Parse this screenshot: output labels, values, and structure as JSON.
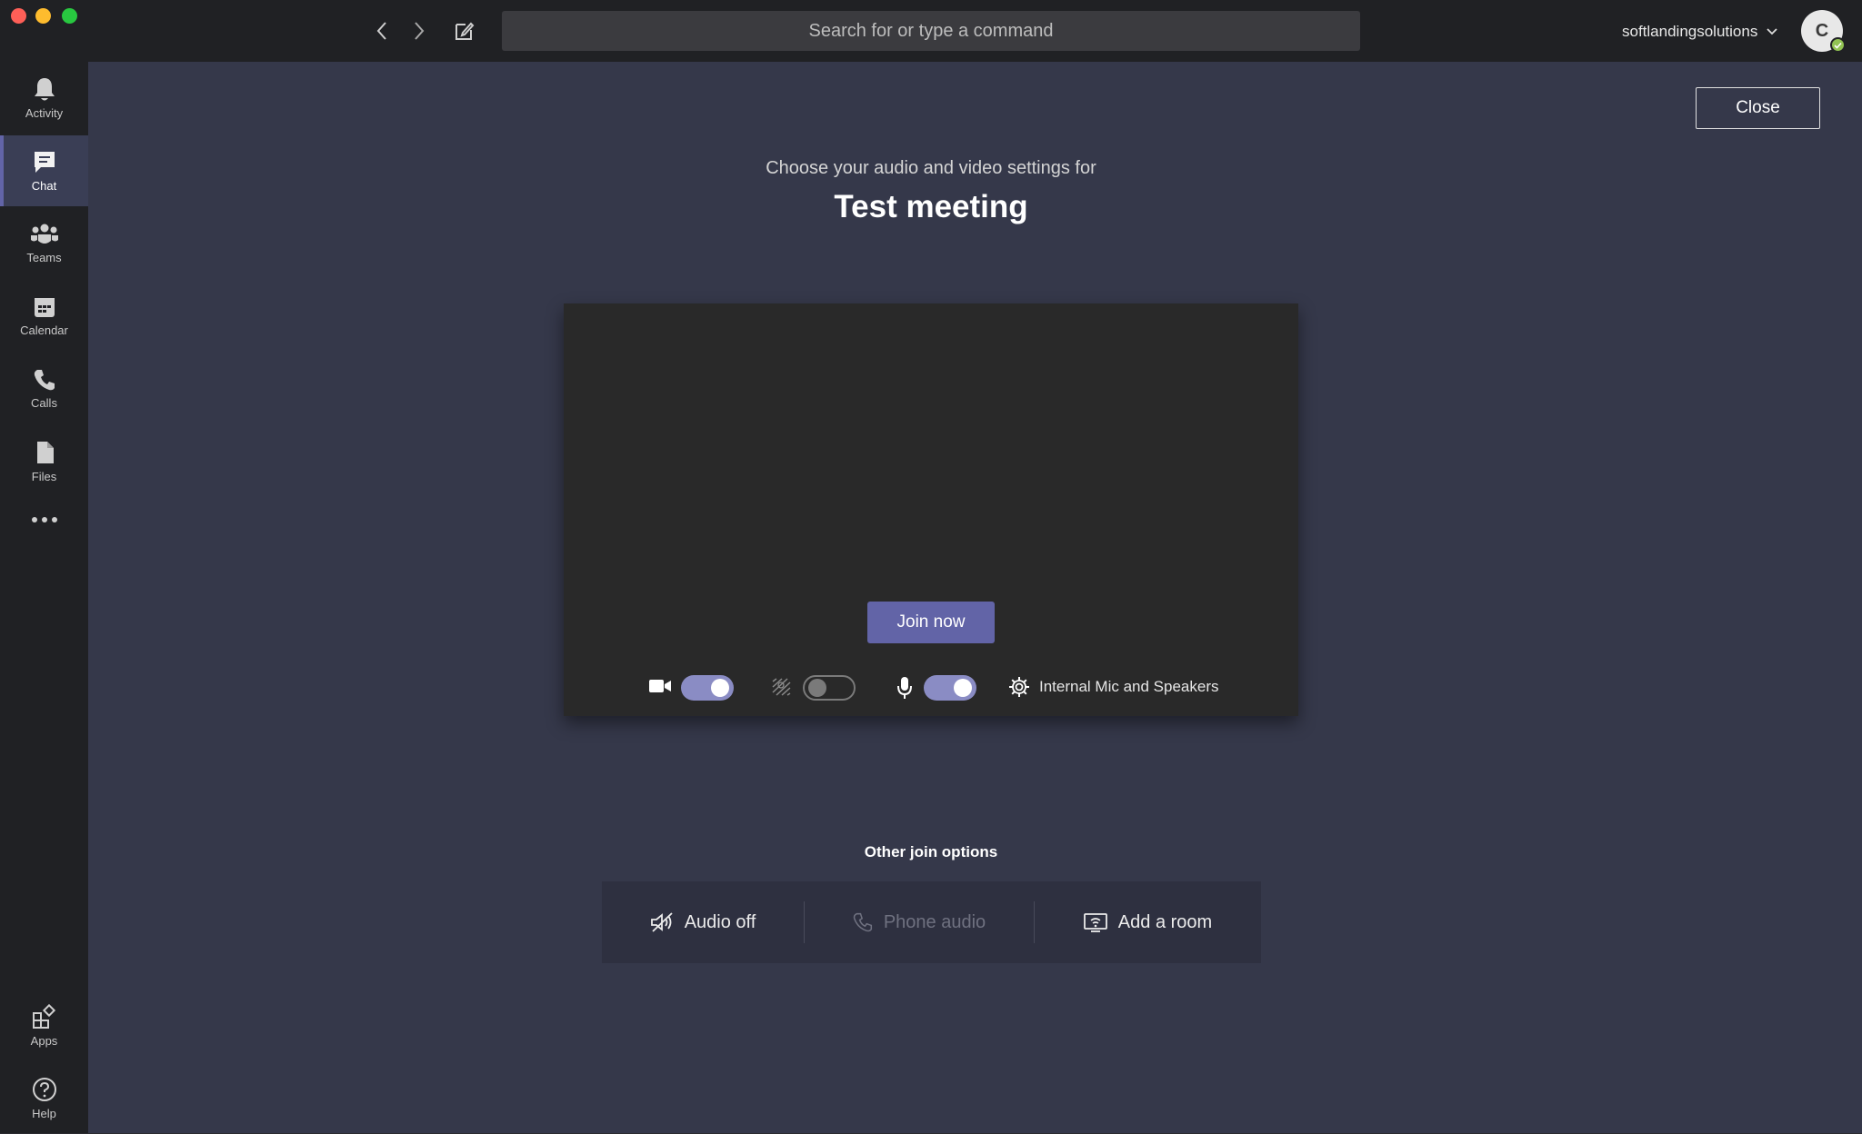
{
  "titlebar": {
    "search_placeholder": "Search for or type a command",
    "org_name": "softlandingsolutions",
    "avatar_initial": "C"
  },
  "rail": {
    "items": [
      {
        "label": "Activity",
        "icon": "bell-icon"
      },
      {
        "label": "Chat",
        "icon": "chat-icon",
        "active": true
      },
      {
        "label": "Teams",
        "icon": "teams-icon"
      },
      {
        "label": "Calendar",
        "icon": "calendar-icon"
      },
      {
        "label": "Calls",
        "icon": "phone-icon"
      },
      {
        "label": "Files",
        "icon": "file-icon"
      }
    ],
    "bottom": [
      {
        "label": "Apps",
        "icon": "apps-icon"
      },
      {
        "label": "Help",
        "icon": "help-icon"
      }
    ]
  },
  "main": {
    "close_label": "Close",
    "subtitle": "Choose your audio and video settings for",
    "meeting_title": "Test meeting",
    "join_label": "Join now",
    "camera_on": true,
    "blur_on": false,
    "mic_on": true,
    "device_label": "Internal Mic and Speakers",
    "other_title": "Other join options",
    "options": [
      {
        "label": "Audio off",
        "icon": "speaker-off-icon",
        "enabled": true
      },
      {
        "label": "Phone audio",
        "icon": "phone-icon",
        "enabled": false
      },
      {
        "label": "Add a room",
        "icon": "cast-room-icon",
        "enabled": true
      }
    ]
  },
  "colors": {
    "accent": "#6264a7",
    "toggle_on": "#8a8cc4",
    "presence": "#92c353",
    "rail_bg": "#202124",
    "main_bg": "#35384a"
  }
}
